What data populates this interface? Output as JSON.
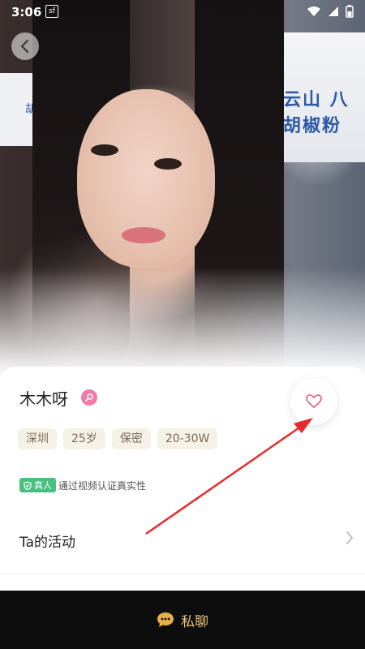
{
  "status_bar": {
    "time": "3:06",
    "app_icon": "sf"
  },
  "photo": {
    "sign_text": "日云山 八类胡椒粉",
    "sign_left_text": "胡椒"
  },
  "profile": {
    "name": "木木呀",
    "tags": [
      "深圳",
      "25岁",
      "保密",
      "20-30W"
    ],
    "real_badge": "真人",
    "real_description": "通过视频认证真实性"
  },
  "activity": {
    "label": "Ta的活动"
  },
  "bottom": {
    "chat_label": "私聊"
  },
  "colors": {
    "accent_pink": "#f07aa8",
    "heart": "#e25a7a",
    "real_green": "#48c07f",
    "chat_gold": "#e8c278",
    "arrow_red": "#e62a2a"
  },
  "icons": {
    "back": "chevron-left-icon",
    "verify": "search-badge-icon",
    "like": "heart-icon",
    "chat": "chat-bubble-icon",
    "arrow": "chevron-right-icon"
  }
}
